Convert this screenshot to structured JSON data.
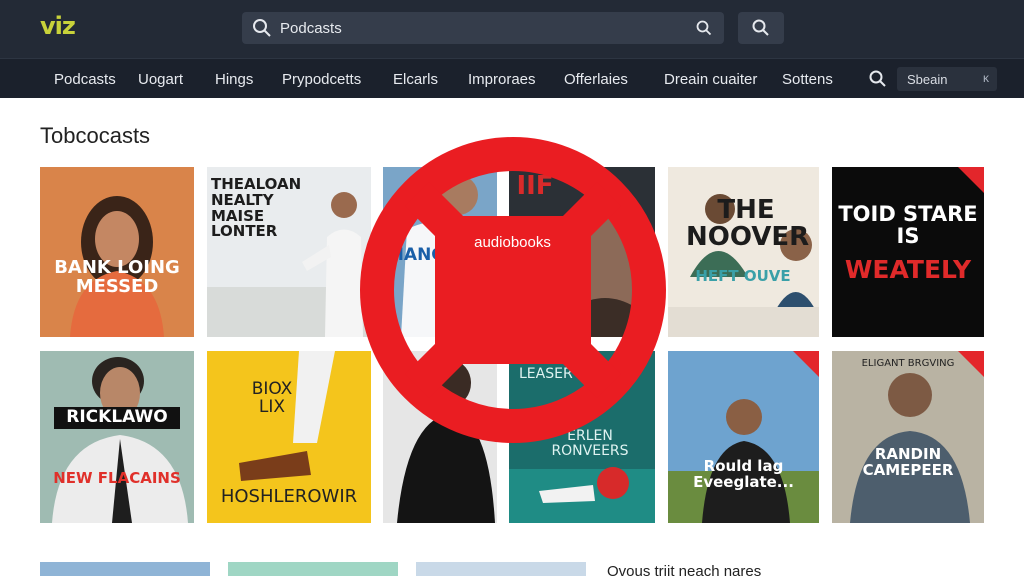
{
  "app": {
    "logo": "viz"
  },
  "search": {
    "value": "Podcasts",
    "placeholder": "Podcasts"
  },
  "nav": {
    "items": [
      "Podcasts",
      "Uogart",
      "Hings",
      "Prypodcetts",
      "Elcarls",
      "Improraes",
      "Offerlaies",
      "Dreain cuaiter",
      "Sottens"
    ],
    "mini_search_value": "Sbeain",
    "mini_search_close": "ĸ"
  },
  "section": {
    "title": "Tobcocasts"
  },
  "overlay": {
    "label": "audiobooks",
    "color": "#ea1d22"
  },
  "cards": [
    {
      "text": "BANK LOING MESSED"
    },
    {
      "text": "THEALOAN NEALTY MAISE LONTER"
    },
    {
      "text": "MANGIP"
    },
    {
      "text": "IIF"
    },
    {
      "text": "THE NOOVER",
      "subtext": "HEFT OUVE"
    },
    {
      "text": "TOID STARE IS",
      "subtext": "WEATELY",
      "badge": ""
    },
    {
      "text": "RICKLAWO",
      "subtext": "NEW FLACAINS"
    },
    {
      "text": "BIOX LIX",
      "subtext": "HOSHLEROWIR"
    },
    {
      "text": ""
    },
    {
      "text": "LEASER",
      "subtext": "ERLEN RONVEERS"
    },
    {
      "text": "Rould lag Eveeglate...",
      "badge": ""
    },
    {
      "text": "ELIGANT BRGVING",
      "subtext": "RANDIN CAMEPEER",
      "badge": ""
    }
  ],
  "footer": {
    "text": "Ovous triit neach nares"
  },
  "colors": {
    "topbar": "#232a36",
    "nav": "#1b212c",
    "logo": "#c8d23a",
    "badge": "#e3262b"
  }
}
